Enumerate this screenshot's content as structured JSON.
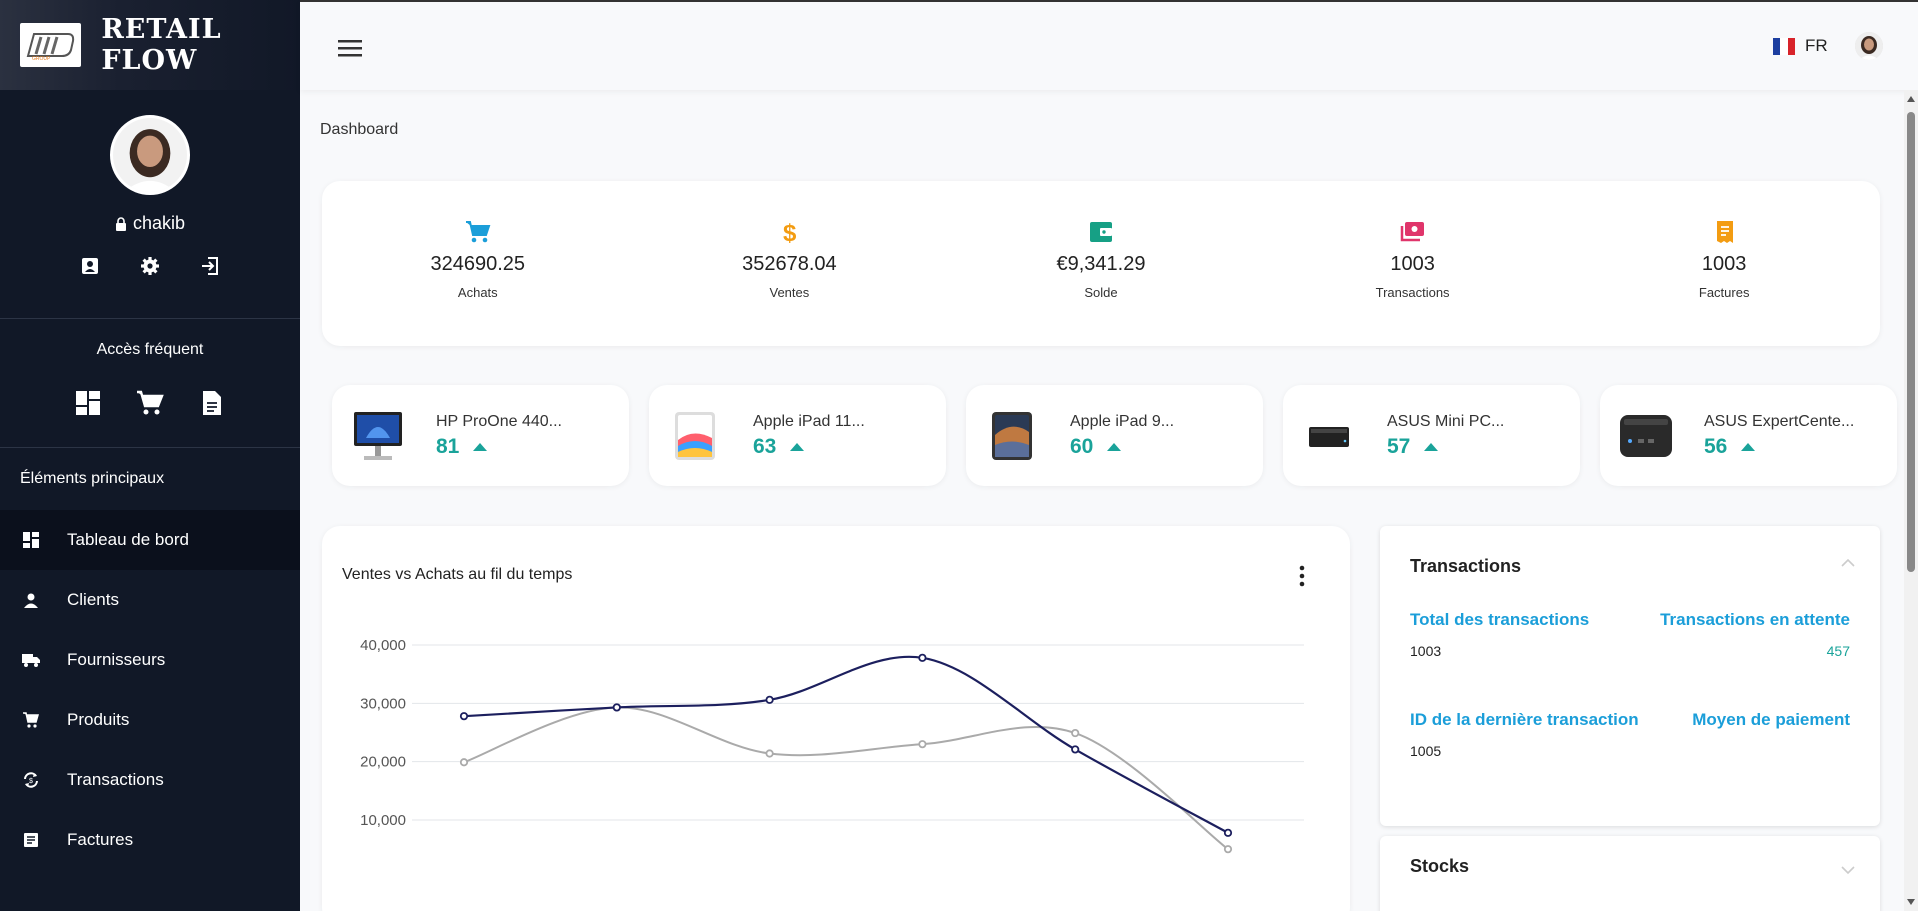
{
  "brand": {
    "title": "RETAIL FLOW"
  },
  "profile": {
    "username": "chakib"
  },
  "frequent": {
    "title": "Accès fréquent"
  },
  "sidebar": {
    "section_title": "Éléments principaux",
    "items": [
      {
        "label": "Tableau de bord",
        "icon": "dashboard-icon"
      },
      {
        "label": "Clients",
        "icon": "person-icon"
      },
      {
        "label": "Fournisseurs",
        "icon": "truck-icon"
      },
      {
        "label": "Produits",
        "icon": "cart-icon"
      },
      {
        "label": "Transactions",
        "icon": "sync-icon"
      },
      {
        "label": "Factures",
        "icon": "receipt-icon"
      }
    ]
  },
  "topbar": {
    "language": "FR"
  },
  "breadcrumb": "Dashboard",
  "stats": [
    {
      "value": "324690.25",
      "label": "Achats",
      "icon": "cart-icon",
      "color": "#1b9ed9"
    },
    {
      "value": "352678.04",
      "label": "Ventes",
      "icon": "dollar-icon",
      "color": "#f39c12"
    },
    {
      "value": "€9,341.29",
      "label": "Solde",
      "icon": "wallet-icon",
      "color": "#16a085"
    },
    {
      "value": "1003",
      "label": "Transactions",
      "icon": "cash-icon",
      "color": "#e0356b"
    },
    {
      "value": "1003",
      "label": "Factures",
      "icon": "invoice-icon",
      "color": "#f39c12"
    }
  ],
  "top_products": [
    {
      "name": "HP ProOne 440...",
      "count": "81",
      "icon": "monitor-icon"
    },
    {
      "name": "Apple iPad 11...",
      "count": "63",
      "icon": "tablet-icon"
    },
    {
      "name": "Apple iPad 9...",
      "count": "60",
      "icon": "tablet-icon"
    },
    {
      "name": "ASUS Mini PC...",
      "count": "57",
      "icon": "minipc-icon"
    },
    {
      "name": "ASUS ExpertCente...",
      "count": "56",
      "icon": "minipc-icon"
    }
  ],
  "chart": {
    "title": "Ventes vs Achats au fil du temps"
  },
  "chart_data": {
    "type": "line",
    "title": "Ventes vs Achats au fil du temps",
    "x": [
      1,
      2,
      3,
      4,
      5,
      6
    ],
    "ylim": [
      0,
      40000
    ],
    "yticks": [
      "10,000",
      "20,000",
      "30,000",
      "40,000"
    ],
    "grid": true,
    "series": [
      {
        "values": [
          27800,
          29300,
          30600,
          37800,
          22100,
          7800
        ],
        "color": "#1c1f5e"
      },
      {
        "values": [
          19900,
          29300,
          21400,
          23000,
          24900,
          5000
        ],
        "color": "#aaaaaa"
      }
    ]
  },
  "transactions": {
    "title": "Transactions",
    "total_label": "Total des transactions",
    "total_value": "1003",
    "pending_label": "Transactions en attente",
    "pending_value": "457",
    "last_id_label": "ID de la dernière transaction",
    "last_id_value": "1005",
    "payment_label": "Moyen de paiement"
  },
  "stocks": {
    "title": "Stocks"
  }
}
